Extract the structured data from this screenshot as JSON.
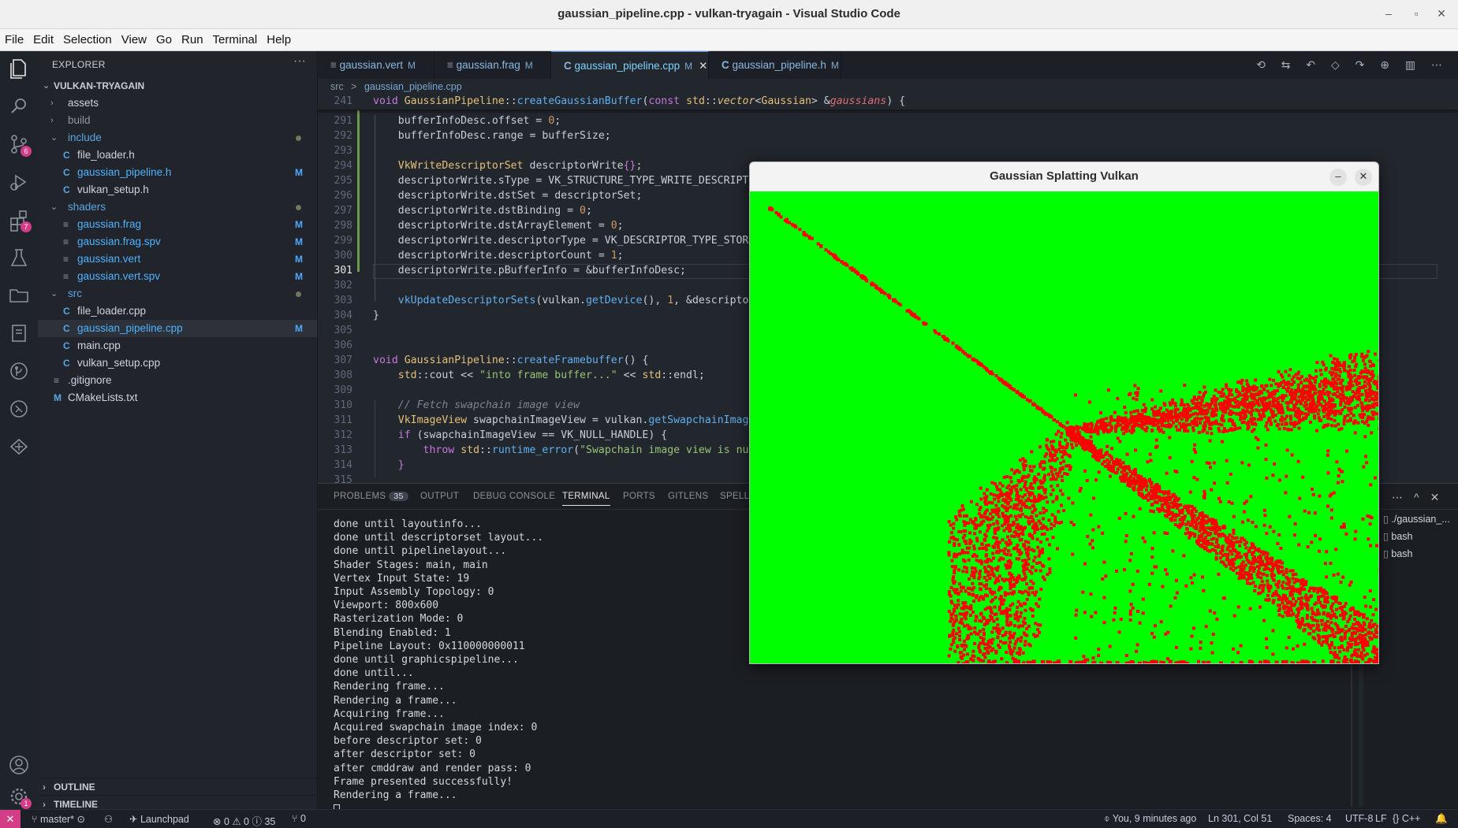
{
  "window": {
    "title": "gaussian_pipeline.cpp - vulkan-tryagain - Visual Studio Code",
    "controls": [
      "–",
      "▫",
      "✕"
    ]
  },
  "menu": [
    "File",
    "Edit",
    "Selection",
    "View",
    "Go",
    "Run",
    "Terminal",
    "Help"
  ],
  "activity_bar": {
    "icons": [
      "explorer-icon",
      "search-icon",
      "source-control-icon",
      "run-debug-icon",
      "extensions-icon",
      "testing-icon",
      "folder-icon",
      "notebook-icon",
      "gitlens-icon",
      "remote-icon",
      "docker-icon",
      "account-icon",
      "settings-icon"
    ],
    "badges": {
      "source_control": "6",
      "extensions": "7",
      "settings": "1"
    }
  },
  "sidebar": {
    "header": "EXPLORER",
    "more": "···",
    "root": "VULKAN-TRYAGAIN",
    "items": [
      {
        "label": "assets",
        "kind": "folder",
        "state": "closed",
        "depth": 1
      },
      {
        "label": "build",
        "kind": "folder",
        "state": "closed",
        "depth": 1
      },
      {
        "label": "include",
        "kind": "folder",
        "state": "open",
        "depth": 1
      },
      {
        "label": "file_loader.h",
        "kind": "c-header",
        "depth": 2
      },
      {
        "label": "gaussian_pipeline.h",
        "kind": "c-header",
        "depth": 2,
        "status": "M"
      },
      {
        "label": "vulkan_setup.h",
        "kind": "c-header",
        "depth": 2
      },
      {
        "label": "shaders",
        "kind": "folder",
        "state": "open",
        "depth": 1
      },
      {
        "label": "gaussian.frag",
        "kind": "text",
        "depth": 2,
        "status": "M"
      },
      {
        "label": "gaussian.frag.spv",
        "kind": "text",
        "depth": 2,
        "status": "M"
      },
      {
        "label": "gaussian.vert",
        "kind": "text",
        "depth": 2,
        "status": "M"
      },
      {
        "label": "gaussian.vert.spv",
        "kind": "text",
        "depth": 2,
        "status": "M"
      },
      {
        "label": "src",
        "kind": "folder",
        "state": "open",
        "depth": 1
      },
      {
        "label": "file_loader.cpp",
        "kind": "c-source",
        "depth": 2
      },
      {
        "label": "gaussian_pipeline.cpp",
        "kind": "cpp-source",
        "depth": 2,
        "status": "M",
        "selected": true
      },
      {
        "label": "main.cpp",
        "kind": "c-source",
        "depth": 2
      },
      {
        "label": "vulkan_setup.cpp",
        "kind": "c-source",
        "depth": 2
      },
      {
        "label": ".gitignore",
        "kind": "text",
        "depth": 1
      },
      {
        "label": "CMakeLists.txt",
        "kind": "cmake",
        "depth": 1
      }
    ],
    "sections": [
      "OUTLINE",
      "TIMELINE"
    ]
  },
  "tabs": [
    {
      "label": "gaussian.vert",
      "status": "M",
      "icon": "≡"
    },
    {
      "label": "gaussian.frag",
      "status": "M",
      "icon": "≡"
    },
    {
      "label": "gaussian_pipeline.cpp",
      "status": "M",
      "icon": "C",
      "active": true,
      "close": "✕"
    },
    {
      "label": "gaussian_pipeline.h",
      "status": "M",
      "icon": "C"
    }
  ],
  "tab_actions": "⟲ ⇆ ↶ ◇ ↷ ⊕ ▥ ⋯",
  "breadcrumb": {
    "folder": "src",
    "sep": ">",
    "file": "gaussian_pipeline.cpp"
  },
  "code": {
    "sticky_line_number": "241",
    "current_line": "301",
    "lines": [
      {
        "n": "241",
        "html": "<span class='k'>void</span> <span class='t'>GaussianPipeline</span>::<span class='f'>createGaussianBuffer</span>(<span class='k'>const</span> <span class='t'>std</span>::<span class='ty'>vector</span>&lt;<span class='t'>Gaussian</span>&gt; &amp;<span class='p'>gaussians</span>) {"
      },
      {
        "n": "291",
        "html": "    bufferInfoDesc.offset = <span class='n'>0</span>;"
      },
      {
        "n": "292",
        "html": "    bufferInfoDesc.range = bufferSize;"
      },
      {
        "n": "293",
        "html": ""
      },
      {
        "n": "294",
        "html": "    <span class='t'>VkWriteDescriptorSet</span> descriptorWrite<span class='k'>{}</span>;"
      },
      {
        "n": "295",
        "html": "    descriptorWrite.sType = VK_STRUCTURE_TYPE_WRITE_DESCRIPTOR_SET;"
      },
      {
        "n": "296",
        "html": "    descriptorWrite.dstSet = descriptorSet;"
      },
      {
        "n": "297",
        "html": "    descriptorWrite.dstBinding = <span class='n'>0</span>;"
      },
      {
        "n": "298",
        "html": "    descriptorWrite.dstArrayElement = <span class='n'>0</span>;"
      },
      {
        "n": "299",
        "html": "    descriptorWrite.descriptorType = VK_DESCRIPTOR_TYPE_STORAGE_BUFFER;"
      },
      {
        "n": "300",
        "html": "    descriptorWrite.descriptorCount = <span class='n'>1</span>;"
      },
      {
        "n": "301",
        "html": "    descriptorWrite.pBufferInfo = &amp;bufferInfoDesc;"
      },
      {
        "n": "302",
        "html": ""
      },
      {
        "n": "303",
        "html": "    <span class='f'>vkUpdateDescriptorSets</span>(vulkan.<span class='f'>getDevice</span>(), <span class='n'>1</span>, &amp;descriptorWrite, <span class='n'>0</span>, nullptr);"
      },
      {
        "n": "304",
        "html": "}"
      },
      {
        "n": "305",
        "html": ""
      },
      {
        "n": "306",
        "html": ""
      },
      {
        "n": "307",
        "html": "<span class='k'>void</span> <span class='t'>GaussianPipeline</span>::<span class='f'>createFramebuffer</span>() {"
      },
      {
        "n": "308",
        "html": "    <span class='t'>std</span>::cout &lt;&lt; <span class='s'>\"into frame buffer...\"</span> &lt;&lt; <span class='t'>std</span>::endl;"
      },
      {
        "n": "309",
        "html": ""
      },
      {
        "n": "310",
        "html": "    <span class='cm'>// Fetch swapchain image view</span>"
      },
      {
        "n": "311",
        "html": "    <span class='t'>VkImageView</span> swapchainImageView = vulkan.<span class='f'>getSwapchainImageView</span>();"
      },
      {
        "n": "312",
        "html": "    <span class='k'>if</span> (swapchainImageView == VK_NULL_HANDLE) {"
      },
      {
        "n": "313",
        "html": "        <span class='k'>throw</span> <span class='t'>std</span>::<span class='f'>runtime_error</span>(<span class='s'>\"Swapchain image view is null\"</span>);"
      },
      {
        "n": "314",
        "html": "    <span class='k'>}</span>"
      },
      {
        "n": "315",
        "html": ""
      }
    ]
  },
  "panel": {
    "tabs": [
      {
        "label": "PROBLEMS",
        "count": "35"
      },
      {
        "label": "OUTPUT"
      },
      {
        "label": "DEBUG CONSOLE"
      },
      {
        "label": "TERMINAL",
        "active": true
      },
      {
        "label": "PORTS"
      },
      {
        "label": "GITLENS"
      },
      {
        "label": "SPELL"
      }
    ],
    "actions": [
      "⋯",
      "^",
      "✕"
    ],
    "terminal_lines": [
      "done until layoutinfo...",
      "done until descriptorset layout...",
      "done until pipelinelayout...",
      "Shader Stages: main, main",
      "Vertex Input State: 19",
      "Input Assembly Topology: 0",
      "Viewport: 800x600",
      "Rasterization Mode: 0",
      "Blending Enabled: 1",
      "Pipeline Layout: 0x110000000011",
      "done until graphicspipeline...",
      "done until...",
      "Rendering frame...",
      "Rendering a frame...",
      "Acquiring frame...",
      "Acquired swapchain image index: 0",
      "before descriptor set: 0",
      "after descriptor set: 0",
      "after cmddraw and render pass: 0",
      "Frame presented successfully!",
      "Rendering a frame..."
    ],
    "terminal_list": [
      "./gaussian_...",
      "bash",
      "bash"
    ]
  },
  "status": {
    "remote": "✕",
    "branch": "master*",
    "sync": "⊙",
    "launchpad": "Launchpad",
    "problems": "⊗ 0 ⚠ 0 ⓘ 35",
    "ports": "⑂ 0",
    "blame": "You, 9 minutes ago",
    "position": "Ln 301, Col 51",
    "spaces": "Spaces: 4",
    "encoding": "UTF-8",
    "eol": "LF",
    "language": "{} C++",
    "bell": "🔔"
  },
  "vulkan_window": {
    "title": "Gaussian Splatting Vulkan",
    "minimize": "–",
    "close": "✕",
    "background": "#00ff00",
    "splat_color": "#ff0000"
  },
  "colors": {
    "accent": "#528bff",
    "modified": "#4fa8ff",
    "badge": "#d33d88"
  }
}
